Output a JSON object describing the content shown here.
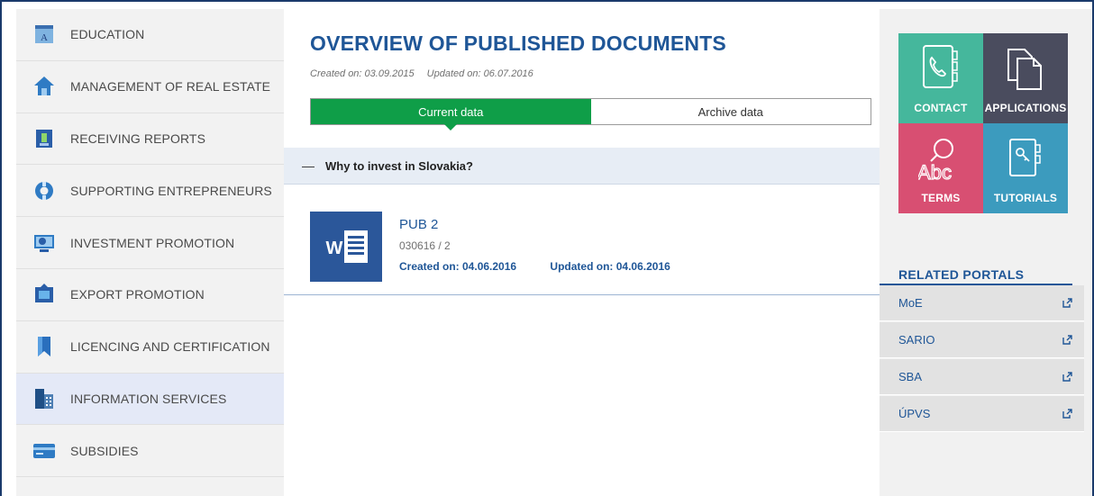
{
  "sidebar": {
    "items": [
      {
        "label": "EDUCATION",
        "icon": "education-icon"
      },
      {
        "label": "MANAGEMENT OF REAL ESTATE",
        "icon": "real-estate-icon"
      },
      {
        "label": "RECEIVING REPORTS",
        "icon": "reports-icon"
      },
      {
        "label": "SUPPORTING ENTREPRENEURS",
        "icon": "lifebuoy-icon"
      },
      {
        "label": "INVESTMENT PROMOTION",
        "icon": "investment-icon"
      },
      {
        "label": "EXPORT PROMOTION",
        "icon": "export-icon"
      },
      {
        "label": "LICENCING AND CERTIFICATION",
        "icon": "bookmark-icon"
      },
      {
        "label": "INFORMATION SERVICES",
        "icon": "building-icon",
        "active": true
      },
      {
        "label": "SUBSIDIES",
        "icon": "card-icon"
      }
    ]
  },
  "main": {
    "title": "OVERVIEW OF PUBLISHED DOCUMENTS",
    "created": "Created on: 03.09.2015",
    "updated": "Updated on: 06.07.2016",
    "tabs": [
      {
        "label": "Current data",
        "active": true
      },
      {
        "label": "Archive data",
        "active": false
      }
    ],
    "accordion": {
      "toggle": "—",
      "label": "Why to invest in Slovakia?"
    },
    "document": {
      "icon": "word-icon",
      "name": "PUB 2",
      "code": "030616 / 2",
      "created": "Created on: 04.06.2016",
      "updated": "Updated on: 04.06.2016"
    }
  },
  "right": {
    "tiles": [
      {
        "label": "CONTACT",
        "icon": "contact-book-icon",
        "color": "#45b79c"
      },
      {
        "label": "APPLICATIONS",
        "icon": "documents-icon",
        "color": "#4a4c5e"
      },
      {
        "label": "TERMS",
        "icon": "abc-search-icon",
        "color": "#d84f72"
      },
      {
        "label": "TUTORIALS",
        "icon": "key-book-icon",
        "color": "#3c9bbe"
      }
    ],
    "related_title": "RELATED PORTALS",
    "portals": [
      {
        "label": "MoE",
        "icon": "external-link-icon"
      },
      {
        "label": "SARIO",
        "icon": "external-link-icon"
      },
      {
        "label": "SBA",
        "icon": "external-link-icon"
      },
      {
        "label": "ÚPVS",
        "icon": "external-link-icon"
      }
    ]
  },
  "colors": {
    "brand_blue": "#1f5697",
    "active_green": "#0f9e48",
    "word_blue": "#2b579a"
  }
}
